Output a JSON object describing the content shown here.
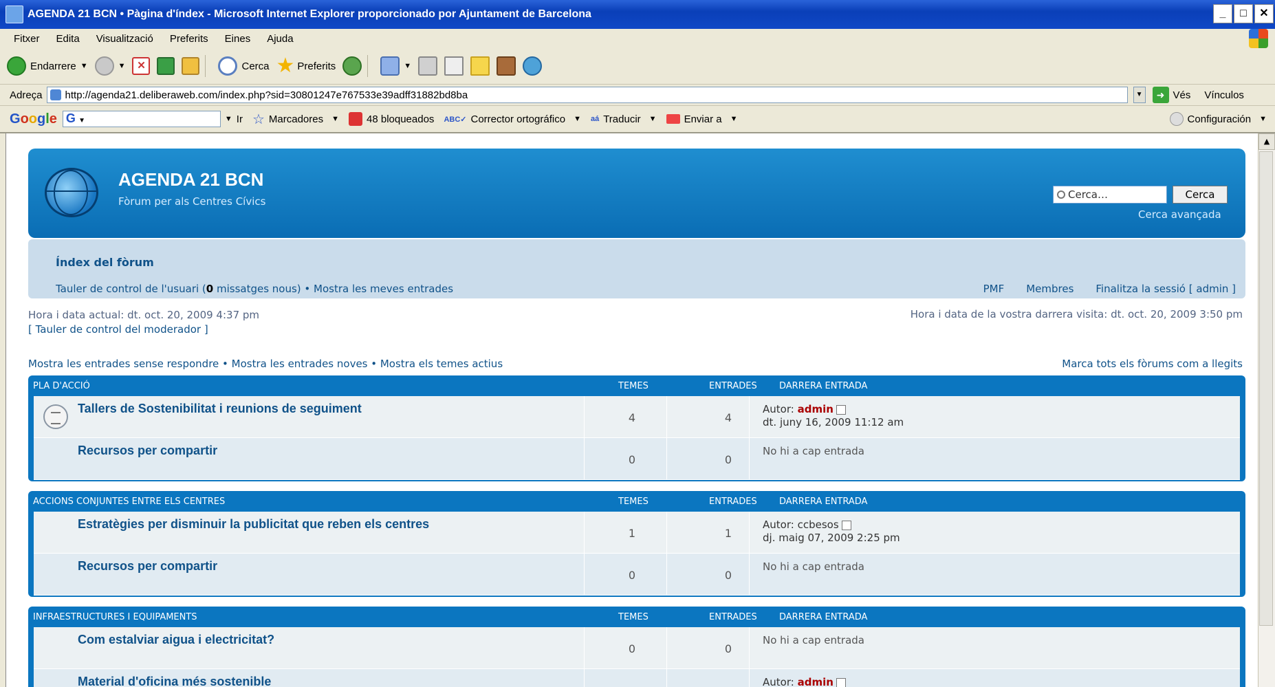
{
  "window": {
    "title": "AGENDA 21 BCN • Pàgina d'índex - Microsoft Internet Explorer proporcionado por Ajuntament de Barcelona",
    "minimize": "_",
    "maximize": "□",
    "close": "✕"
  },
  "menu": [
    "Fitxer",
    "Edita",
    "Visualització",
    "Preferits",
    "Eines",
    "Ajuda"
  ],
  "toolbar": {
    "back_label": "Endarrere",
    "search_label": "Cerca",
    "favorites_label": "Preferits"
  },
  "address": {
    "label": "Adreça",
    "url": "http://agenda21.deliberaweb.com/index.php?sid=30801247e767533e39adff31882bd8ba",
    "go_label": "Vés",
    "links_label": "Vínculos"
  },
  "googlebar": {
    "logo": [
      "G",
      "o",
      "o",
      "g",
      "l",
      "e"
    ],
    "search_prefix": "G",
    "go_label": "Ir",
    "bookmarks_label": "Marcadores",
    "blocked_label": "48 bloqueados",
    "spell_label": "Corrector ortográfico",
    "translate_label": "Traducir",
    "send_label": "Enviar a",
    "settings_label": "Configuración"
  },
  "forum": {
    "site_title": "AGENDA 21 BCN",
    "site_description": "Fòrum per als Centres Cívics",
    "search_placeholder": "Cerca…",
    "search_button": "Cerca",
    "advanced_search": "Cerca avançada",
    "nav_index": "Índex del fòrum",
    "ucp_prefix": "Tauler de control de l'usuari (",
    "ucp_count": "0",
    "ucp_suffix": " missatges nous) • Mostra les meves entrades",
    "nav_faq": "PMF",
    "nav_members": "Membres",
    "nav_logout": "Finalitza la sessió [ admin ]",
    "current_time": "Hora i data actual: dt. oct. 20, 2009 4:37 pm",
    "moderator_panel": "[ Tauler de control del moderador ]",
    "last_visit": "Hora i data de la vostra darrera visita: dt. oct. 20, 2009 3:50 pm",
    "search_links": "Mostra les entrades sense respondre • Mostra les entrades noves • Mostra els temes actius",
    "mark_read": "Marca tots els fòrums com a llegits",
    "col_topics": "TEMES",
    "col_posts": "ENTRADES",
    "col_last": "DARRERA ENTRADA",
    "author_prefix": "Autor:",
    "categories": [
      {
        "name": "PLA D'ACCIÓ",
        "forums": [
          {
            "title": "Tallers de Sostenibilitat i reunions de seguiment",
            "topics": "4",
            "posts": "4",
            "author": "admin",
            "date": "dt. juny 16, 2009 11:12 am",
            "no_entry": ""
          },
          {
            "title": "Recursos per compartir",
            "topics": "0",
            "posts": "0",
            "author": "",
            "date": "",
            "no_entry": "No hi a cap entrada"
          }
        ]
      },
      {
        "name": "ACCIONS CONJUNTES ENTRE ELS CENTRES",
        "forums": [
          {
            "title": "Estratègies per disminuir la publicitat que reben els centres",
            "topics": "1",
            "posts": "1",
            "author": "ccbesos",
            "date": "dj. maig 07, 2009 2:25 pm",
            "no_entry": ""
          },
          {
            "title": "Recursos per compartir",
            "topics": "0",
            "posts": "0",
            "author": "",
            "date": "",
            "no_entry": "No hi a cap entrada"
          }
        ]
      },
      {
        "name": "INFRAESTRUCTURES I EQUIPAMENTS",
        "forums": [
          {
            "title": "Com estalviar aigua i electricitat?",
            "topics": "0",
            "posts": "0",
            "author": "",
            "date": "",
            "no_entry": "No hi a cap entrada"
          },
          {
            "title": "Material d'oficina més sostenible",
            "topics": "",
            "posts": "",
            "author": "admin",
            "date": "",
            "no_entry": ""
          }
        ]
      }
    ]
  }
}
